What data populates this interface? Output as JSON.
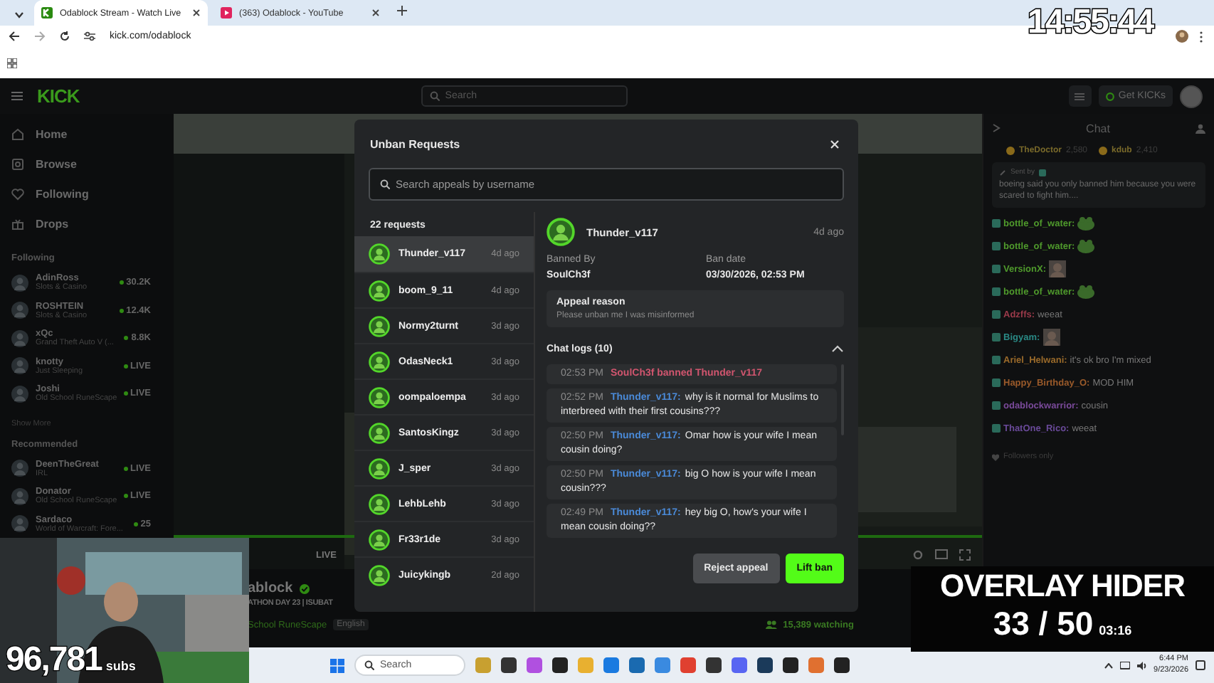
{
  "browser": {
    "tabs": [
      {
        "title": "Odablock Stream - Watch Live",
        "selected": true
      },
      {
        "title": "(363) Odablock - YouTube",
        "selected": false
      }
    ],
    "url": "kick.com/odablock"
  },
  "clock_overlay": "14:55:44",
  "site": {
    "logo": "KICK",
    "search": {
      "placeholder": "Search"
    },
    "get_kicks": "Get KICKs"
  },
  "sidebar": {
    "nav": [
      {
        "label": "Home"
      },
      {
        "label": "Browse"
      },
      {
        "label": "Following"
      },
      {
        "label": "Drops"
      }
    ],
    "following_title": "Following",
    "following": [
      {
        "name": "AdinRoss",
        "category": "Slots & Casino",
        "viewers": "30.2K"
      },
      {
        "name": "ROSHTEIN",
        "category": "Slots & Casino",
        "viewers": "12.4K"
      },
      {
        "name": "xQc",
        "category": "Grand Theft Auto V (...",
        "viewers": "8.8K"
      },
      {
        "name": "knotty",
        "category": "Just Sleeping",
        "viewers": "LIVE"
      },
      {
        "name": "Joshi",
        "category": "Old School RuneScape",
        "viewers": "LIVE"
      }
    ],
    "show_more": "Show More",
    "recommended_title": "Recommended",
    "recommended": [
      {
        "name": "DeenTheGreat",
        "category": "IRL",
        "viewers": "LIVE"
      },
      {
        "name": "Donator",
        "category": "Old School RuneScape",
        "viewers": "LIVE"
      },
      {
        "name": "Sardaco",
        "category": "World of Warcraft: Fore...",
        "viewers": "25"
      }
    ]
  },
  "player": {
    "live": "LIVE"
  },
  "stream_info": {
    "streamer": "ablock",
    "verified": true,
    "title": "ATHON DAY 23 | ISUBAT",
    "category": "School RuneScape",
    "tag": "English",
    "watching": "15,389 watching"
  },
  "chat": {
    "title": "Chat",
    "leaders": [
      {
        "name": "TheDoctor",
        "count": "2,580"
      },
      {
        "name": "kdub",
        "count": "2,410"
      }
    ],
    "pinned": {
      "label": "Sent by",
      "text": "boeing said you only banned him because you were scared to fight him...."
    },
    "messages": [
      {
        "kind": "frog",
        "user": "bottle_of_water:",
        "color": "#4f9a2c"
      },
      {
        "kind": "frog",
        "user": "bottle_of_water:",
        "color": "#4f9a2c"
      },
      {
        "user": "VersionX:",
        "color": "#4f9a2c"
      },
      {
        "kind": "frog",
        "user": "bottle_of_water:",
        "color": "#4f9a2c"
      },
      {
        "kind": "text",
        "user": "Adzffs:",
        "color": "#9a3a4a",
        "text": "weeat"
      },
      {
        "user": "Bigyam:",
        "color": "#2a8a86"
      },
      {
        "kind": "text",
        "user": "Ariel_Helwani:",
        "color": "#9a6a2a",
        "text": "it's ok bro I'm mixed"
      },
      {
        "kind": "text",
        "user": "Happy_Birthday_O:",
        "color": "#9a5a2a",
        "text": "MOD HIM"
      },
      {
        "kind": "text",
        "user": "odablockwarrior:",
        "color": "#7a4a9a",
        "text": "cousin"
      },
      {
        "kind": "text",
        "user": "ThatOne_Rico:",
        "color": "#6a4a9a",
        "text": "weeat"
      }
    ],
    "mode": "Followers only"
  },
  "modal": {
    "title": "Unban Requests",
    "search": {
      "placeholder": "Search appeals by username"
    },
    "count": "22 requests",
    "requests": [
      {
        "user": "Thunder_v117",
        "time": "4d ago",
        "selected": true
      },
      {
        "user": "boom_9_11",
        "time": "4d ago",
        "selected": false
      },
      {
        "user": "Normy2turnt",
        "time": "3d ago",
        "selected": false
      },
      {
        "user": "OdasNeck1",
        "time": "3d ago",
        "selected": false
      },
      {
        "user": "oompaloempa",
        "time": "3d ago",
        "selected": false
      },
      {
        "user": "SantosKingz",
        "time": "3d ago",
        "selected": false
      },
      {
        "user": "J_sper",
        "time": "3d ago",
        "selected": false
      },
      {
        "user": "LehbLehb",
        "time": "3d ago",
        "selected": false
      },
      {
        "user": "Fr33r1de",
        "time": "3d ago",
        "selected": false
      },
      {
        "user": "Juicykingb",
        "time": "2d ago",
        "selected": false
      }
    ],
    "detail": {
      "user": "Thunder_v117",
      "time": "4d ago",
      "banned_by_label": "Banned By",
      "banned_by": "SoulCh3f",
      "ban_date_label": "Ban date",
      "ban_date": "03/30/2026, 02:53 PM",
      "reason_label": "Appeal reason",
      "reason": "Please unban me I was misinformed",
      "logs_title": "Chat logs (10)",
      "logs_expanded": true,
      "logs": [
        {
          "kind": "ban",
          "time": "02:53 PM",
          "text": "SoulCh3f banned Thunder_v117"
        },
        {
          "kind": "message",
          "time": "02:52 PM",
          "user": "Thunder_v117:",
          "text": "why is it normal for Muslims to interbreed with their first cousins???"
        },
        {
          "kind": "message",
          "time": "02:50 PM",
          "user": "Thunder_v117:",
          "text": "Omar how is your wife I mean cousin doing?"
        },
        {
          "kind": "message",
          "time": "02:50 PM",
          "user": "Thunder_v117:",
          "text": "big O how is your wife I mean cousin???"
        },
        {
          "kind": "message",
          "time": "02:49 PM",
          "user": "Thunder_v117:",
          "text": "hey big O, how's your wife I mean cousin doing??"
        }
      ]
    },
    "buttons": [
      {
        "label": "Reject appeal",
        "kind": "secondary"
      },
      {
        "label": "Lift ban",
        "kind": "primary"
      }
    ]
  },
  "webcam": {
    "subs_count": "96,781",
    "subs_label": "subs"
  },
  "overlay_hider": {
    "title": "OVERLAY HIDER",
    "count": "33 / 50",
    "timer": "03:16"
  },
  "taskbar": {
    "search": {
      "placeholder": "Search"
    },
    "time": "6:44 PM",
    "date": "9/23/2026"
  }
}
